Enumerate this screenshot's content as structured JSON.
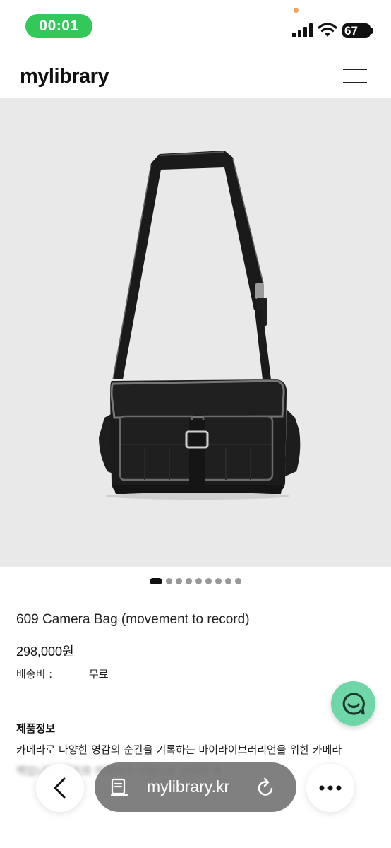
{
  "status_bar": {
    "time": "00:01",
    "battery": "67"
  },
  "header": {
    "logo": "mylibrary",
    "menu_icon": "hamburger-menu-icon"
  },
  "carousel": {
    "total": 10,
    "active_index": 0
  },
  "product": {
    "title": "609 Camera Bag (movement to record)",
    "price": "298,000원",
    "shipping_label": "배송비 :",
    "shipping_value": "무료",
    "info_heading": "제품정보",
    "description_line_1": "카메라로 다양한 영감의 순간을 기록하는 마이라이브러리언을 위한 카메라",
    "description_line_2_partial": "백입니다. 렌즈와 카메라가 가죽으로 감싸여 적"
  },
  "browser": {
    "url": "mylibrary.kr"
  },
  "colors": {
    "status_pill": "#34c759",
    "chat_button": "#6fd6a8",
    "image_bg": "#e9e9e9"
  }
}
